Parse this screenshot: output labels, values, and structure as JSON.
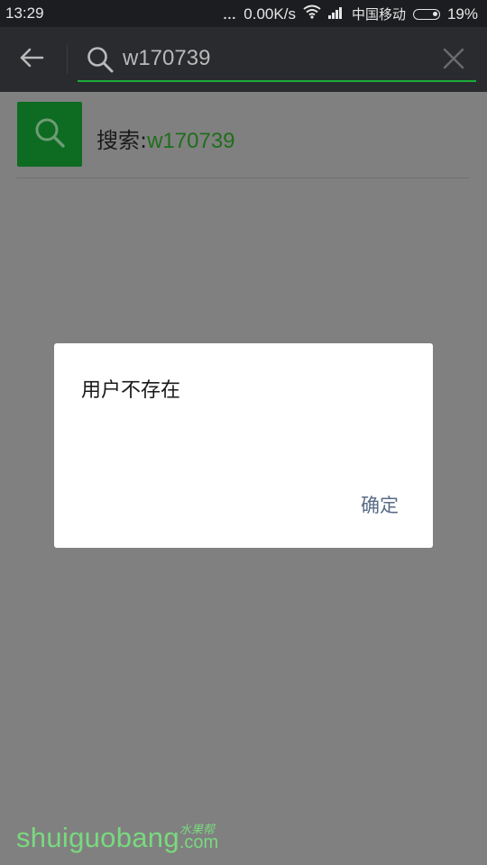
{
  "status_bar": {
    "time": "13:29",
    "dots": "...",
    "network_speed": "0.00K/s",
    "wifi_icon": "wifi-icon",
    "signal_icon": "signal-bars-icon",
    "carrier": "中国移动",
    "battery_icon": "battery-icon",
    "battery_percent": "19%"
  },
  "search_bar": {
    "back_icon": "back-arrow-icon",
    "search_icon": "search-icon",
    "query": "w170739",
    "clear_icon": "close-icon",
    "underline_color": "#1aab38"
  },
  "result": {
    "icon": "search-icon",
    "prefix": "搜索:",
    "term": "w170739"
  },
  "dialog": {
    "message": "用户不存在",
    "confirm_label": "确定"
  },
  "watermark": {
    "main": "shuiguobang",
    "cn": "水果帮",
    "tld": ".com",
    "color": "#79d97e"
  }
}
